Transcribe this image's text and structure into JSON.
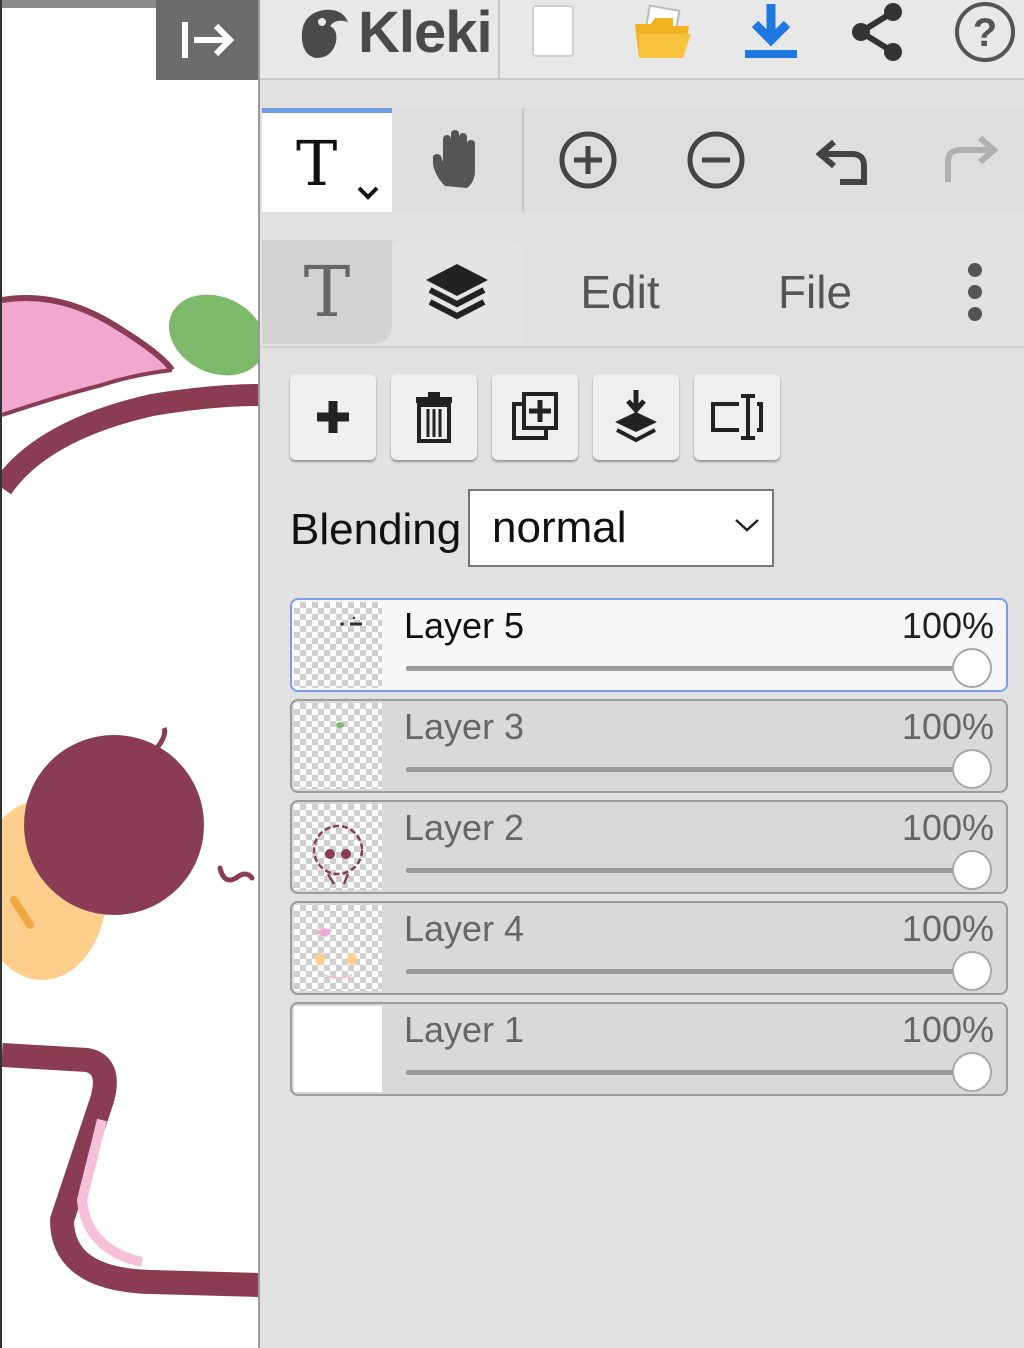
{
  "app": {
    "name": "Kleki"
  },
  "colors": {
    "accent": "#6c9ee6",
    "download": "#1f78e0",
    "folder": "#f0b21e",
    "panel_bg": "#e1e1e1"
  },
  "topbar": {
    "icons": [
      "collapse-arrow-icon",
      "new-file-icon",
      "open-folder-icon",
      "download-icon",
      "share-icon",
      "help-icon"
    ],
    "help_label": "?"
  },
  "toolbar": {
    "tools": [
      "text-tool",
      "hand-tool",
      "zoom-in",
      "zoom-out",
      "undo",
      "redo"
    ],
    "active_tool_glyph": "T"
  },
  "tabs": {
    "text_glyph": "T",
    "edit": "Edit",
    "file": "File",
    "active": "layers"
  },
  "layers_panel": {
    "actions": [
      "add-layer",
      "delete-layer",
      "duplicate-layer",
      "merge-down",
      "rename-layer"
    ],
    "blending_label": "Blending",
    "blending_value": "normal",
    "layers": [
      {
        "name": "Layer 5",
        "opacity": "100%",
        "opacity_value": 1.0,
        "active": true
      },
      {
        "name": "Layer 3",
        "opacity": "100%",
        "opacity_value": 1.0,
        "active": false
      },
      {
        "name": "Layer 2",
        "opacity": "100%",
        "opacity_value": 1.0,
        "active": false
      },
      {
        "name": "Layer 4",
        "opacity": "100%",
        "opacity_value": 1.0,
        "active": false
      },
      {
        "name": "Layer 1",
        "opacity": "100%",
        "opacity_value": 1.0,
        "active": false
      }
    ]
  }
}
